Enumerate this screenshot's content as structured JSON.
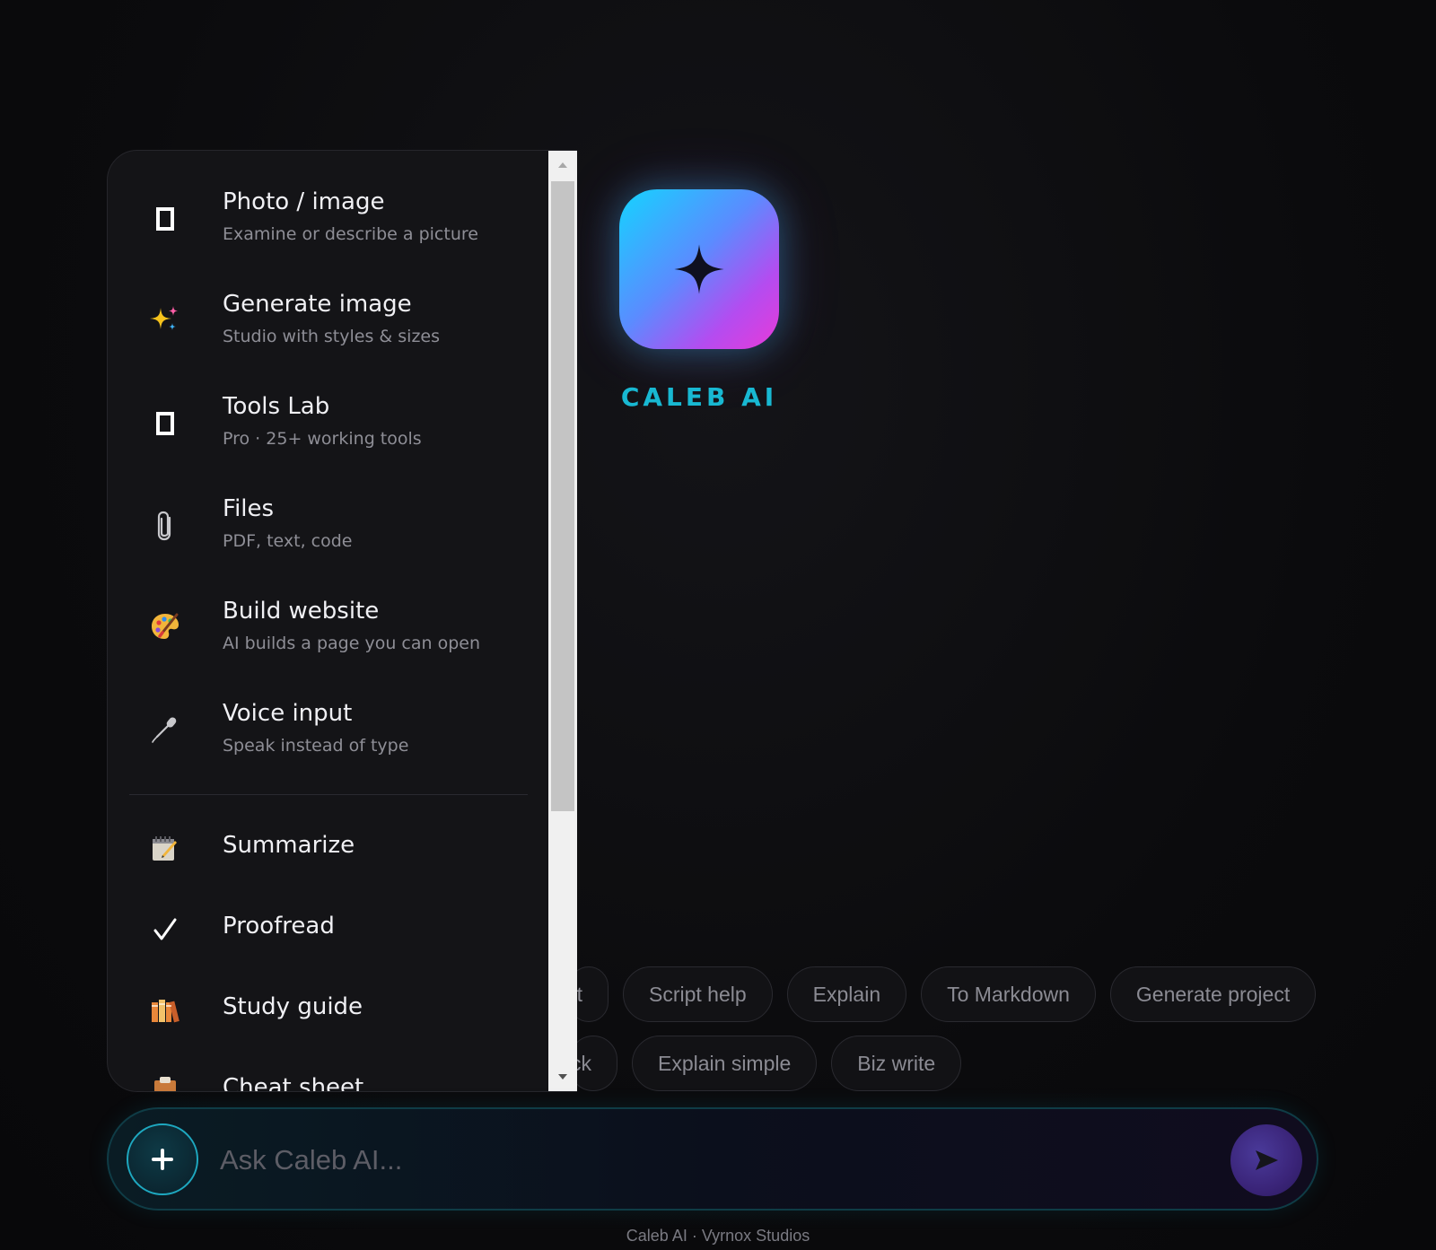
{
  "brand": {
    "name": "CALEB AI"
  },
  "menu": {
    "items": [
      {
        "title": "Photo / image",
        "subtitle": "Examine or describe a picture",
        "icon": "image-frame-icon"
      },
      {
        "title": "Generate image",
        "subtitle": "Studio with styles & sizes",
        "icon": "sparkles-icon"
      },
      {
        "title": "Tools Lab",
        "subtitle": "Pro · 25+ working tools",
        "icon": "box-icon"
      },
      {
        "title": "Files",
        "subtitle": "PDF, text, code",
        "icon": "paperclip-icon"
      },
      {
        "title": "Build website",
        "subtitle": "AI builds a page you can open",
        "icon": "palette-icon"
      },
      {
        "title": "Voice input",
        "subtitle": "Speak instead of type",
        "icon": "microphone-icon"
      }
    ],
    "actions": [
      {
        "title": "Summarize",
        "icon": "memo-icon"
      },
      {
        "title": "Proofread",
        "icon": "checkmark-icon"
      },
      {
        "title": "Study guide",
        "icon": "books-icon"
      },
      {
        "title": "Cheat sheet",
        "icon": "clipboard-icon"
      }
    ]
  },
  "chips": {
    "row1": [
      "t",
      "Script help",
      "Explain",
      "To Markdown",
      "Generate project"
    ],
    "row2": [
      "ck",
      "Explain simple",
      "Biz write"
    ]
  },
  "composer": {
    "placeholder": "Ask Caleb AI..."
  },
  "footer": {
    "text": "Caleb AI · Vyrnox Studios"
  },
  "colors": {
    "accent_cyan": "#18b8d2",
    "logo_gradient_start": "#14d4ff",
    "logo_gradient_end": "#e83ad8",
    "background": "#0c0c0e"
  }
}
